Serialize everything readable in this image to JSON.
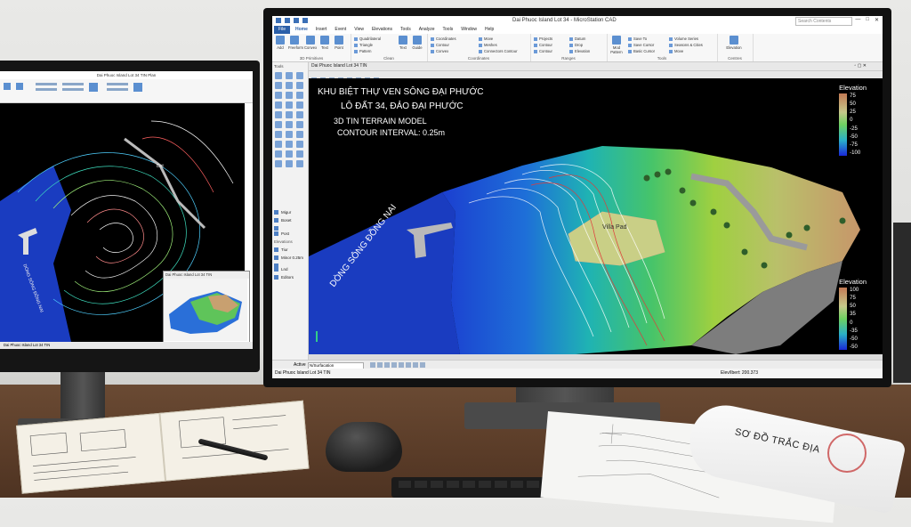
{
  "right_app": {
    "window_title": "Dai Phuoc Island Lot 34 - MicroStation CAD",
    "search_placeholder": "Search Contents",
    "window_controls": [
      "—",
      "□",
      "✕"
    ],
    "menu": {
      "file": "File",
      "items": [
        "Home",
        "Insert",
        "Event",
        "View",
        "Elevations",
        "Tools",
        "Analyze",
        "Tools",
        "Window",
        "Help"
      ]
    },
    "ribbon": {
      "groups": [
        {
          "label": "3D Primitives",
          "buttons": [
            "Add",
            "Freeform",
            "Convex",
            "Text",
            "Point"
          ]
        },
        {
          "label": "Clean",
          "buttons": [
            "Text",
            "Guide"
          ],
          "small": [
            "Quadrilateral",
            "Triangle",
            "Pattern"
          ]
        },
        {
          "label": "Coordinates",
          "small": [
            "Coordinates",
            "Contour",
            "Convex",
            "Move",
            "Meshes",
            "Connectors Contour"
          ]
        },
        {
          "label": "Ranges",
          "small": [
            "Projects",
            "Contour",
            "Contour",
            "Datum",
            "Drop",
            "Elevation"
          ]
        },
        {
          "label": "Tools",
          "buttons": [
            "Mod Pattern"
          ],
          "small": [
            "Save To",
            "Save Cursor",
            "Basic Cursor",
            "Volume Series",
            "Seasons & Cities",
            "Move"
          ]
        },
        {
          "label": "Centres",
          "buttons": [
            "Elevation"
          ]
        }
      ]
    },
    "tool_panel": {
      "header": "Tools",
      "list": [
        {
          "label": "Migur",
          "section": false
        },
        {
          "label": "Boset",
          "section": false
        },
        {
          "label": "Post",
          "section": false
        },
        {
          "label": "Elevations",
          "section": true
        },
        {
          "label": "Tiur",
          "section": false
        },
        {
          "label": "Minor 0.25m",
          "section": false
        },
        {
          "label": "Lnd",
          "section": false
        },
        {
          "label": "Editors",
          "section": false
        }
      ]
    },
    "view": {
      "window_title": "Dai Phuoc Island Lot 34 TIN",
      "title_lines": [
        "KHU BIỆT THỰ VEN SÔNG ĐẠI PHƯỚC",
        "LÔ ĐẤT 34, ĐẢO ĐẠI PHƯỚC",
        "3D TIN TERRAIN MODEL",
        "CONTOUR INTERVAL: 0.25m"
      ],
      "river_label": "DÒNG SÔNG ĐỒNG NAI",
      "pad_label": "Villa Pad",
      "legend_top": {
        "title": "Elevation",
        "ticks": [
          "75",
          "50",
          "25",
          "0",
          "-25",
          "-50",
          "-75",
          "-100"
        ]
      },
      "legend_bottom": {
        "title": "Elevation",
        "ticks": [
          "100",
          "75",
          "50",
          "35",
          "0",
          "-35",
          "-50",
          "-50"
        ]
      }
    },
    "status": {
      "level_label": "Active",
      "level_value": "N/Surfacation",
      "file_label": "Dai Phuoc Island Lot 34 TIN",
      "coord": "Elev/Ibert: 200.373"
    }
  },
  "left_app": {
    "window_title": "Dai Phuoc Island Lot 34 TIN Plan",
    "river_label": "DÒNG SÔNG ĐỒNG NAI",
    "peak_label": "Dot",
    "popup_title": "Dai Phuoc Island Lot 34 TIN",
    "status": "Dai Phuoc Island Lot 34 TIN"
  },
  "desk": {
    "roll_title": "SƠ ĐỒ TRẮC ĐỊA"
  },
  "colors": {
    "ribbon_accent": "#2b5fa8",
    "water": "#1a3db8",
    "terrain_low": "#1fa3a8",
    "terrain_mid": "#7fbf3a",
    "terrain_high": "#c89a6a"
  }
}
